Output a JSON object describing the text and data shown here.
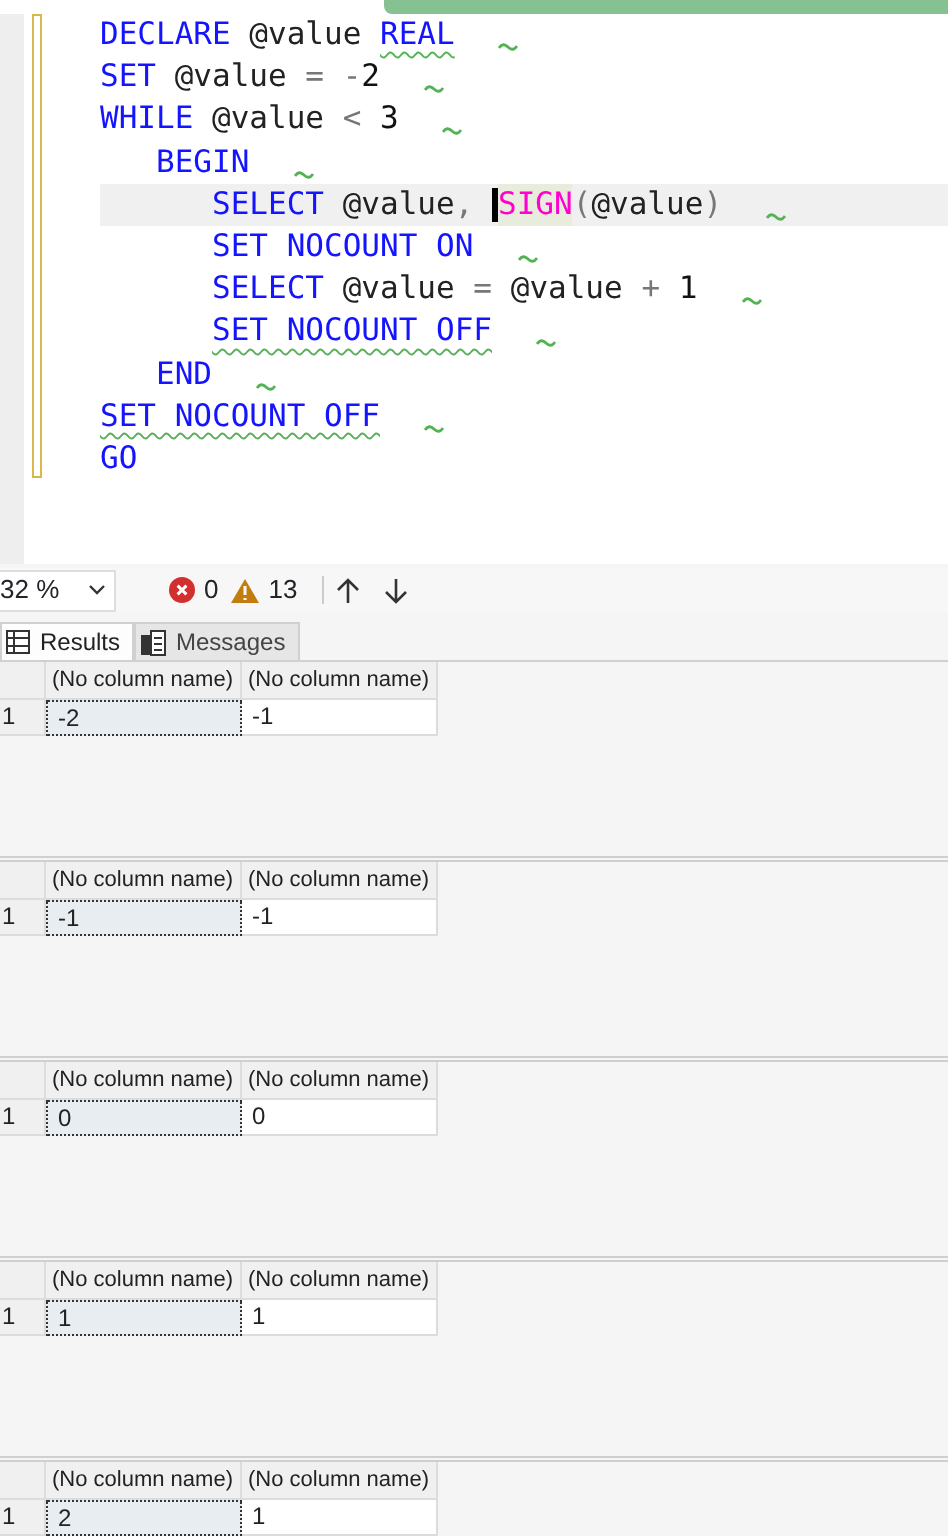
{
  "editor": {
    "lines": [
      {
        "current": false,
        "hint_mark": true,
        "tokens": [
          {
            "text": "DECLARE",
            "kind": "keyword"
          },
          {
            "text": " @value ",
            "kind": "variable"
          },
          {
            "text": "REAL",
            "kind": "keyword",
            "squiggle": true
          }
        ]
      },
      {
        "current": false,
        "hint_mark": true,
        "tokens": [
          {
            "text": "SET",
            "kind": "keyword"
          },
          {
            "text": " @value ",
            "kind": "variable"
          },
          {
            "text": "= -",
            "kind": "operator"
          },
          {
            "text": "2",
            "kind": "number"
          }
        ]
      },
      {
        "current": false,
        "hint_mark": true,
        "tokens": [
          {
            "text": "WHILE",
            "kind": "keyword"
          },
          {
            "text": " @value ",
            "kind": "variable"
          },
          {
            "text": "<",
            "kind": "operator"
          },
          {
            "text": " 3",
            "kind": "number"
          }
        ]
      },
      {
        "current": false,
        "hint_mark": true,
        "tokens": [
          {
            "text": "   BEGIN",
            "kind": "keyword"
          }
        ]
      },
      {
        "current": true,
        "hint_mark": true,
        "tokens": [
          {
            "text": "      SELECT",
            "kind": "keyword"
          },
          {
            "text": " @value",
            "kind": "variable"
          },
          {
            "text": ", ",
            "kind": "operator"
          },
          {
            "text": "SIGN",
            "kind": "function",
            "cursor": true
          },
          {
            "text": "(",
            "kind": "operator"
          },
          {
            "text": "@value",
            "kind": "variable"
          },
          {
            "text": ")",
            "kind": "operator"
          }
        ]
      },
      {
        "current": false,
        "hint_mark": true,
        "tokens": [
          {
            "text": "      SET NOCOUNT ON",
            "kind": "keyword"
          }
        ]
      },
      {
        "current": false,
        "hint_mark": true,
        "tokens": [
          {
            "text": "      SELECT",
            "kind": "keyword"
          },
          {
            "text": " @value ",
            "kind": "variable"
          },
          {
            "text": "=",
            "kind": "operator"
          },
          {
            "text": " @value ",
            "kind": "variable"
          },
          {
            "text": "+",
            "kind": "operator"
          },
          {
            "text": " 1",
            "kind": "number"
          }
        ]
      },
      {
        "current": false,
        "hint_mark": true,
        "tokens": [
          {
            "text": "      SET NOCOUNT OFF",
            "kind": "keyword",
            "squiggle": true
          }
        ]
      },
      {
        "current": false,
        "hint_mark": true,
        "tokens": [
          {
            "text": "   END",
            "kind": "keyword"
          }
        ]
      },
      {
        "current": false,
        "hint_mark": true,
        "tokens": [
          {
            "text": "SET NOCOUNT OFF",
            "kind": "keyword",
            "squiggle": true
          }
        ]
      },
      {
        "current": false,
        "hint_mark": false,
        "tokens": [
          {
            "text": "GO",
            "kind": "keyword"
          }
        ]
      }
    ]
  },
  "toolbar": {
    "zoom": "32 %",
    "errors": "0",
    "warnings": "13"
  },
  "result_tabs": [
    {
      "label": "Results",
      "selected": true
    },
    {
      "label": "Messages",
      "selected": false
    }
  ],
  "result_sets": [
    {
      "columns": [
        "(No column name)",
        "(No column name)"
      ],
      "rows": [
        {
          "row_number": "1",
          "cells": [
            {
              "text": "-2",
              "selected": true
            },
            {
              "text": "-1",
              "selected": false
            }
          ]
        }
      ]
    },
    {
      "columns": [
        "(No column name)",
        "(No column name)"
      ],
      "rows": [
        {
          "row_number": "1",
          "cells": [
            {
              "text": "-1",
              "selected": true
            },
            {
              "text": "-1",
              "selected": false
            }
          ]
        }
      ]
    },
    {
      "columns": [
        "(No column name)",
        "(No column name)"
      ],
      "rows": [
        {
          "row_number": "1",
          "cells": [
            {
              "text": "0",
              "selected": true
            },
            {
              "text": "0",
              "selected": false
            }
          ]
        }
      ]
    },
    {
      "columns": [
        "(No column name)",
        "(No column name)"
      ],
      "rows": [
        {
          "row_number": "1",
          "cells": [
            {
              "text": "1",
              "selected": true
            },
            {
              "text": "1",
              "selected": false
            }
          ]
        }
      ]
    },
    {
      "columns": [
        "(No column name)",
        "(No column name)"
      ],
      "rows": [
        {
          "row_number": "1",
          "cells": [
            {
              "text": "2",
              "selected": true
            },
            {
              "text": "1",
              "selected": false
            }
          ]
        }
      ]
    }
  ]
}
